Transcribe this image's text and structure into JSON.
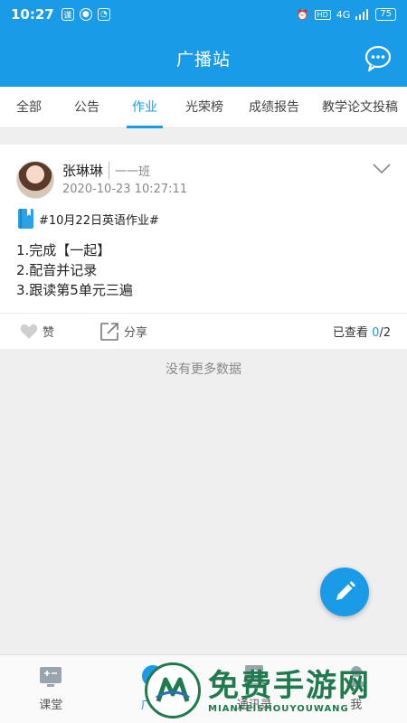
{
  "status_bar": {
    "time": "10:27",
    "app_icon_text": "课",
    "network": "4G",
    "battery": "75"
  },
  "header": {
    "title": "广播站"
  },
  "tabs": [
    {
      "label": "全部"
    },
    {
      "label": "公告"
    },
    {
      "label": "作业",
      "active": true
    },
    {
      "label": "光荣榜"
    },
    {
      "label": "成绩报告"
    },
    {
      "label": "教学论文投稿"
    }
  ],
  "post": {
    "author": "张琳琳",
    "class_name": "一一班",
    "time": "2020-10-23 10:27:11",
    "tag": "#10月22日英语作业#",
    "lines": [
      "1.完成【一起】",
      "2.配音并记录",
      "3.跟读第5单元三遍"
    ],
    "like_label": "赞",
    "share_label": "分享",
    "viewed_label": "已查看",
    "viewed_count": "0",
    "viewed_total": "/2"
  },
  "no_more_label": "没有更多数据",
  "bottom_nav": [
    {
      "label": "课堂",
      "icon": "classroom-icon"
    },
    {
      "label": "广播",
      "icon": "broadcast-icon",
      "active": true
    },
    {
      "label": "通讯录",
      "icon": "contacts-icon"
    },
    {
      "label": "我",
      "icon": "me-icon"
    }
  ],
  "watermark": {
    "title": "免费手游网",
    "subtitle": "MIANFEISHOUYOUWANG"
  },
  "colors": {
    "accent": "#1a9be8",
    "watermark": "#1f7a4d"
  }
}
